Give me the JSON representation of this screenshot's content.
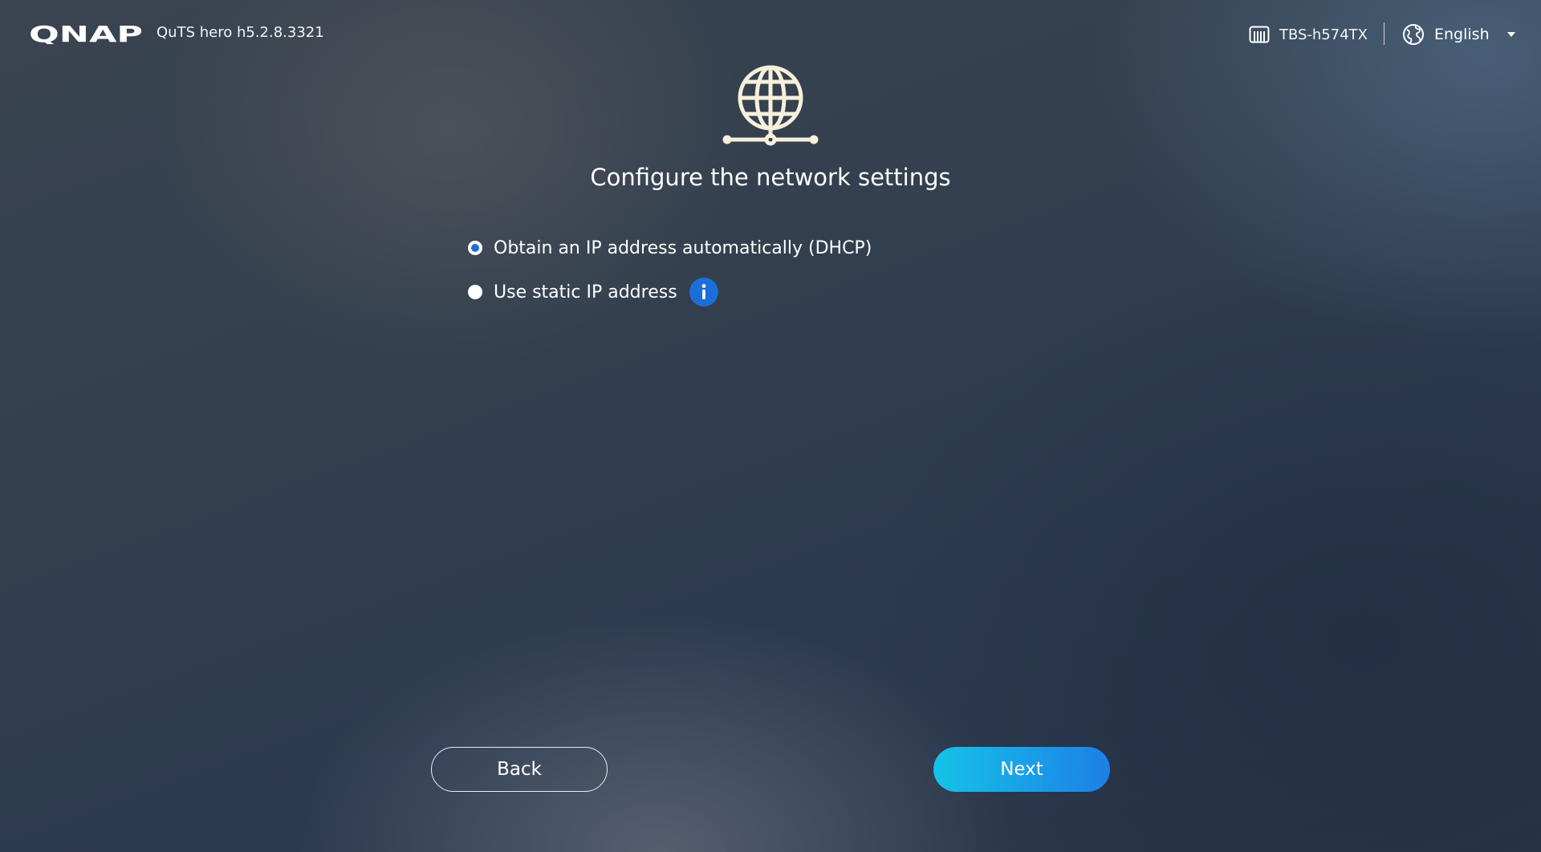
{
  "header": {
    "brand": "QNAP",
    "version": "QuTS hero h5.2.8.3321",
    "device_icon": "nas-device-icon",
    "device_name": "TBS-h574TX",
    "language_icon": "globe-icon",
    "language": "English"
  },
  "page": {
    "hero_icon": "network-globe-icon",
    "title": "Configure the network settings"
  },
  "options": [
    {
      "label": "Obtain an IP address automatically (DHCP)",
      "selected": true
    },
    {
      "label": "Use static IP address",
      "selected": false,
      "info_icon": "info-icon"
    }
  ],
  "buttons": {
    "back": "Back",
    "next": "Next"
  },
  "colors": {
    "accent": "#1a6fd8",
    "next_gradient_start": "#15c3e8",
    "next_gradient_end": "#1d7fe6",
    "hero_icon": "#f6f0dc"
  }
}
